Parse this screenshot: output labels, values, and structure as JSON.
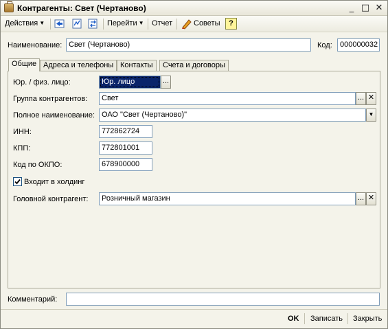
{
  "window": {
    "title": "Контрагенты: Свет (Чертаново)",
    "minimize_glyph": "_",
    "maximize_glyph": "□",
    "close_glyph": "✕"
  },
  "toolbar": {
    "actions_label": "Действия",
    "goto_label": "Перейти",
    "report_label": "Отчет",
    "tips_label": "Советы",
    "help_glyph": "?"
  },
  "header": {
    "name_label": "Наименование:",
    "name_value": "Свет (Чертаново)",
    "code_label": "Код:",
    "code_value": "000000032"
  },
  "tabs": [
    {
      "label": "Общие"
    },
    {
      "label": "Адреса и телефоны"
    },
    {
      "label": "Контакты"
    },
    {
      "label": "Счета и договоры"
    }
  ],
  "form": {
    "legal_type_label": "Юр. / физ. лицо:",
    "legal_type_value": "Юр. лицо",
    "group_label": "Группа контрагентов:",
    "group_value": "Свет",
    "full_name_label": "Полное наименование:",
    "full_name_value": "ОАО \"Свет (Чертаново)\"",
    "inn_label": "ИНН:",
    "inn_value": "772862724",
    "kpp_label": "КПП:",
    "kpp_value": "772801001",
    "okpo_label": "Код по ОКПО:",
    "okpo_value": "678900000",
    "holding_label": "Входит в холдинг",
    "holding_checked": true,
    "parent_label": "Головной контрагент:",
    "parent_value": "Розничный магазин",
    "select_glyph": "...",
    "clear_glyph": "✕",
    "dropdown_glyph": "▼"
  },
  "comment": {
    "label": "Комментарий:",
    "value": ""
  },
  "footer": {
    "ok_label": "OK",
    "save_label": "Записать",
    "close_label": "Закрыть"
  },
  "colors": {
    "window_bg": "#f4f3ea",
    "field_border": "#7f9db9",
    "selection_bg": "#0a246a",
    "selection_text": "#ffffff"
  }
}
